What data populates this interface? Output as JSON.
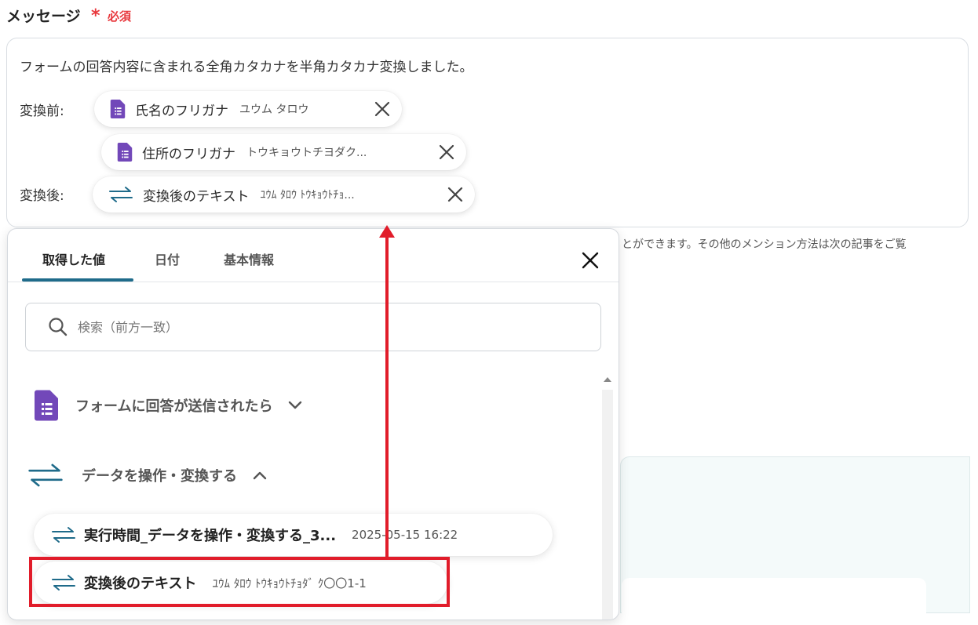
{
  "field": {
    "label": "メッセージ",
    "required_mark": "*",
    "required_text": "必須"
  },
  "message": {
    "line1": "フォームの回答内容に含まれる全角カタカナを半角カタカナ変換しました。",
    "before_label": "変換前:",
    "after_label": "変換後:",
    "chips": [
      {
        "label": "氏名のフリガナ",
        "value": "ユウム タロウ",
        "icon": "google-forms-icon"
      },
      {
        "label": "住所のフリガナ",
        "value": "トウキョウトチヨダク...",
        "icon": "google-forms-icon"
      },
      {
        "label": "変換後のテキスト",
        "value": "ﾕｳﾑ ﾀﾛｳ ﾄｳｷｮｳﾄﾁｮ...",
        "icon": "convert-arrows-icon"
      }
    ]
  },
  "helper_text": "とができます。その他のメンション方法は次の記事をご覧",
  "popup": {
    "tabs": [
      "取得した値",
      "日付",
      "基本情報"
    ],
    "active_tab": 0,
    "search_placeholder": "検索（前方一致）",
    "sections": [
      {
        "label": "フォームに回答が送信されたら",
        "icon": "google-forms-icon",
        "expanded": false
      },
      {
        "label": "データを操作・変換する",
        "icon": "convert-arrows-icon",
        "expanded": true
      }
    ],
    "items": [
      {
        "label": "実行時間_データを操作・変換する_3...",
        "value": "2025-05-15 16:22"
      },
      {
        "label": "変換後のテキスト",
        "value": "ﾕｳﾑ ﾀﾛｳ ﾄｳｷｮｳﾄﾁｮﾀﾞ ｸ〇〇1-1"
      }
    ]
  },
  "colors": {
    "required": "#e8383d",
    "forms_purple": "#7248b9",
    "convert_teal": "#1f6b8a",
    "annotation_red": "#e11c2a"
  }
}
